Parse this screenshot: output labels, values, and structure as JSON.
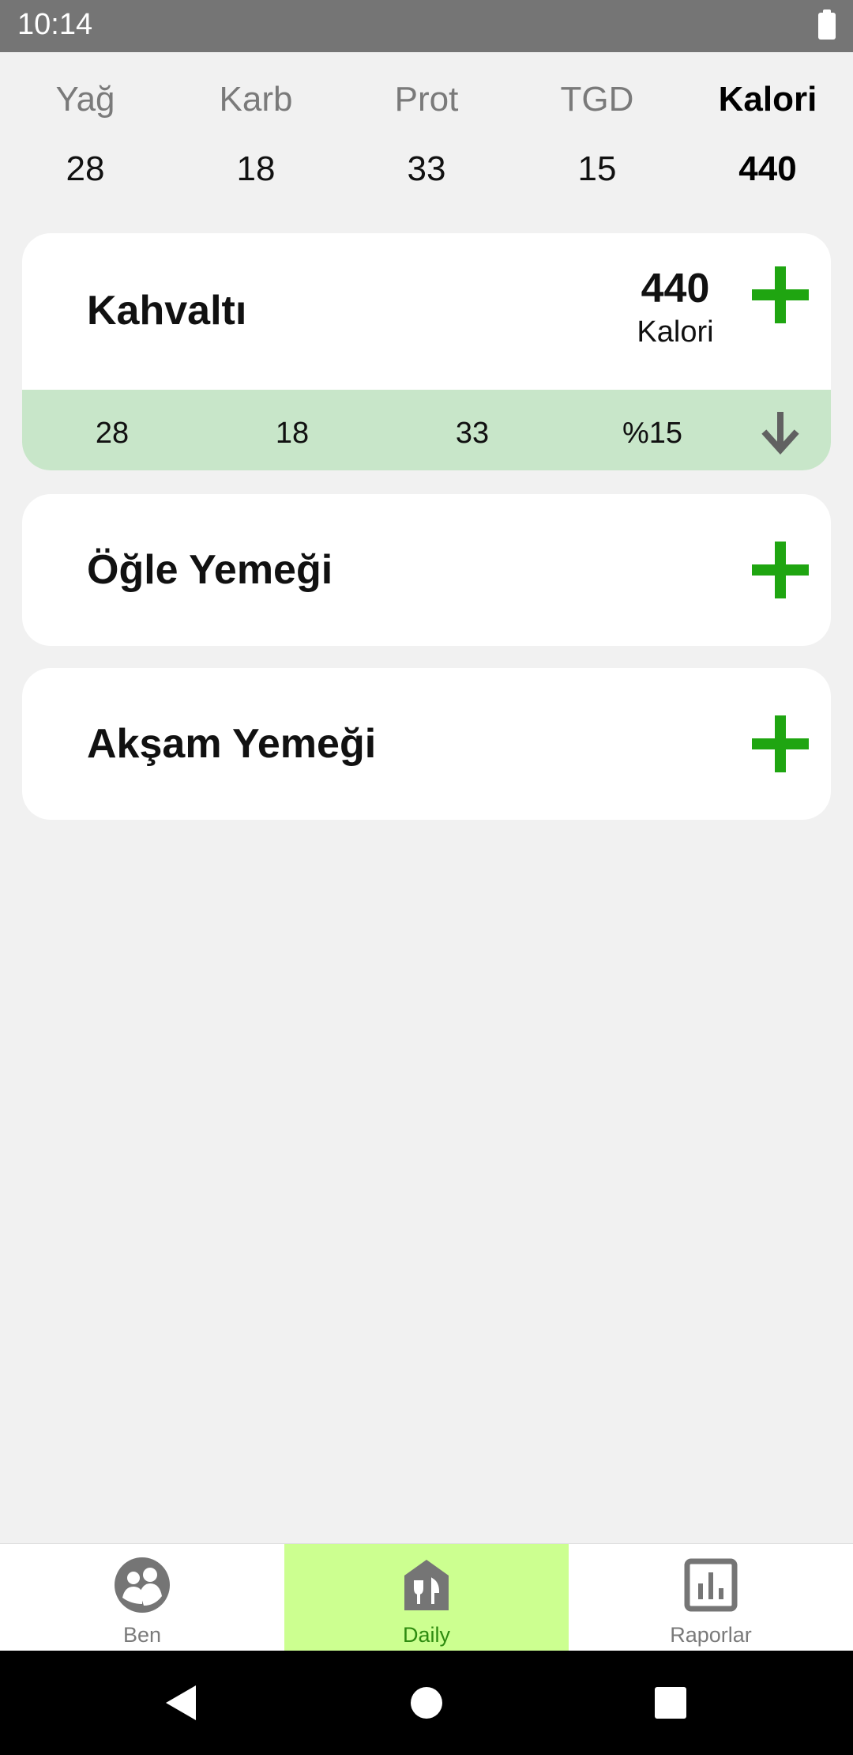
{
  "status_bar": {
    "time": "10:14"
  },
  "summary": [
    {
      "label": "Yağ",
      "value": "28",
      "bold": false
    },
    {
      "label": "Karb",
      "value": "18",
      "bold": false
    },
    {
      "label": "Prot",
      "value": "33",
      "bold": false
    },
    {
      "label": "TGD",
      "value": "15",
      "bold": false
    },
    {
      "label": "Kalori",
      "value": "440",
      "bold": true
    }
  ],
  "meals": {
    "breakfast": {
      "title": "Kahvaltı",
      "calories": "440",
      "calories_label": "Kalori",
      "macros": [
        "28",
        "18",
        "33",
        "%15"
      ],
      "add_icon": "plus-icon",
      "expand_icon": "arrow-down-icon"
    },
    "lunch": {
      "title": "Öğle Yemeği",
      "add_icon": "plus-icon"
    },
    "dinner": {
      "title": "Akşam Yemeği",
      "add_icon": "plus-icon"
    }
  },
  "bottom_nav": {
    "items": [
      {
        "label": "Ben",
        "icon": "people-icon",
        "active": false
      },
      {
        "label": "Daily",
        "icon": "restaurant-home-icon",
        "active": true
      },
      {
        "label": "Raporlar",
        "icon": "bar-chart-icon",
        "active": false
      }
    ]
  },
  "colors": {
    "accent_green": "#1fa511",
    "macro_row_bg": "#c8e6c9",
    "active_nav_bg": "#ccff90",
    "active_nav_text": "#2e8b10"
  }
}
